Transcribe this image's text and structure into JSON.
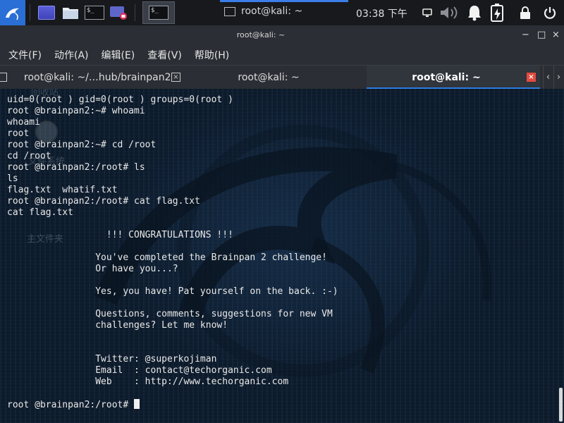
{
  "panel": {
    "taskbar_window_title": "root@kali: ~",
    "clock": "03:38 下午",
    "icons": [
      "kali-dragon-icon",
      "workspace-icon",
      "file-manager-icon",
      "terminal-icon",
      "screen-recorder-icon",
      "terminal-task-icon",
      "network-icon",
      "volume-icon",
      "notification-bell-icon",
      "battery-icon",
      "lock-icon",
      "power-icon"
    ]
  },
  "window": {
    "title": "root@kali: ~",
    "controls": [
      "−",
      "□",
      "×"
    ]
  },
  "menu": [
    "文件(F)",
    "动作(A)",
    "编辑(E)",
    "查看(V)",
    "帮助(H)"
  ],
  "tabs": [
    {
      "label": "root@kali: ~/…hub/brainpan2",
      "active": false
    },
    {
      "label": "root@kali: ~",
      "active": false
    },
    {
      "label": "root@kali: ~",
      "active": true
    }
  ],
  "desktop_ghost": {
    "label1": "回收站",
    "label2": "文件系统",
    "label3": "主文件夹"
  },
  "terminal": {
    "lines": [
      "uid=0(root ) gid=0(root ) groups=0(root )",
      "root @brainpan2:~# whoami",
      "whoami",
      "root",
      "root @brainpan2:~# cd /root",
      "cd /root",
      "root @brainpan2:/root# ls",
      "ls",
      "flag.txt  whatif.txt",
      "root @brainpan2:/root# cat flag.txt",
      "cat flag.txt",
      "",
      "                  !!! CONGRATULATIONS !!!",
      "",
      "                You've completed the Brainpan 2 challenge!",
      "                Or have you...?",
      "",
      "                Yes, you have! Pat yourself on the back. :-)",
      "",
      "                Questions, comments, suggestions for new VM",
      "                challenges? Let me know!",
      "",
      "",
      "                Twitter: @superkojiman",
      "                Email  : contact@techorganic.com",
      "                Web    : http://www.techorganic.com",
      "",
      "root @brainpan2:/root# "
    ]
  },
  "colors": {
    "panel_bg": "#17191d",
    "accent": "#2d7be0",
    "tab_close_active": "#e34a3e",
    "chrome_bg": "#2b2e34",
    "terminal_bg": "#0d1a29"
  }
}
